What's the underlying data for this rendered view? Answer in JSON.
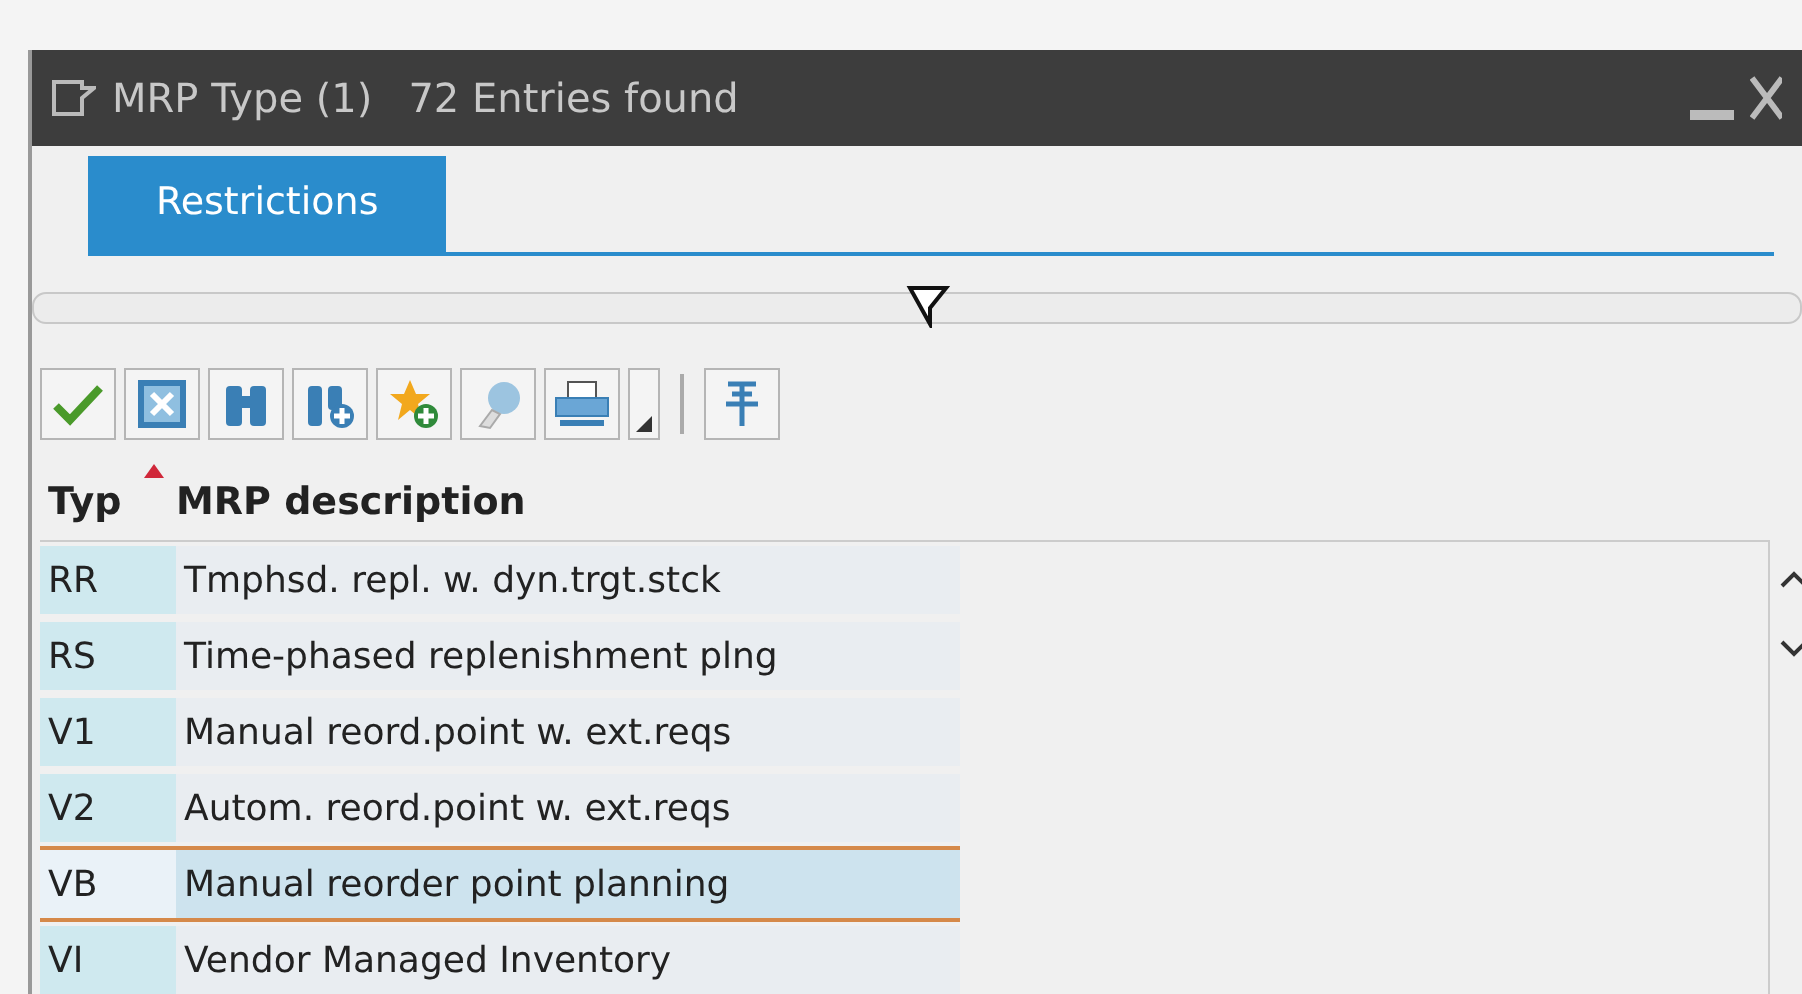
{
  "window": {
    "title": "MRP Type (1)",
    "subtitle": "72 Entries found"
  },
  "tabs": [
    {
      "label": "Restrictions",
      "selected": true
    }
  ],
  "toolbar": [
    {
      "kind": "check"
    },
    {
      "kind": "cancel"
    },
    {
      "kind": "find"
    },
    {
      "kind": "find-next"
    },
    {
      "kind": "favorite-add"
    },
    {
      "kind": "help"
    },
    {
      "kind": "print"
    },
    {
      "kind": "dropdown"
    },
    {
      "kind": "separator"
    },
    {
      "kind": "pin"
    }
  ],
  "table": {
    "columns": [
      {
        "label": "Typ",
        "sorted": true
      },
      {
        "label": "MRP description",
        "sorted": false
      }
    ],
    "rows": [
      {
        "typ": "RR",
        "description": "Tmphsd. repl. w. dyn.trgt.stck",
        "selected": false
      },
      {
        "typ": "RS",
        "description": "Time-phased replenishment plng",
        "selected": false
      },
      {
        "typ": "V1",
        "description": "Manual reord.point w. ext.reqs",
        "selected": false
      },
      {
        "typ": "V2",
        "description": "Autom. reord.point w. ext.reqs",
        "selected": false
      },
      {
        "typ": "VB",
        "description": "Manual reorder point planning",
        "selected": true
      },
      {
        "typ": "VI",
        "description": "Vendor Managed Inventory",
        "selected": false
      }
    ]
  }
}
